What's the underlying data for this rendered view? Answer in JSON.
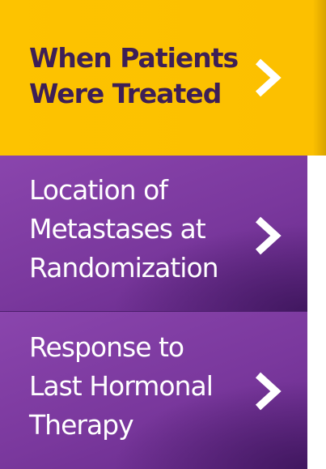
{
  "nav": {
    "items": [
      {
        "label": "When Patients\nWere Treated",
        "state": "active",
        "icon": "chevron-right-icon",
        "color": "#fdc300",
        "text_color": "#3d1f56"
      },
      {
        "label": "Location of\nMetastases at\nRandomization",
        "state": "inactive",
        "icon": "chevron-right-icon",
        "color": "#7a389d",
        "text_color": "#ffffff"
      },
      {
        "label": "Response to\nLast Hormonal\nTherapy",
        "state": "inactive",
        "icon": "chevron-right-icon",
        "color": "#7a389d",
        "text_color": "#ffffff"
      }
    ]
  }
}
